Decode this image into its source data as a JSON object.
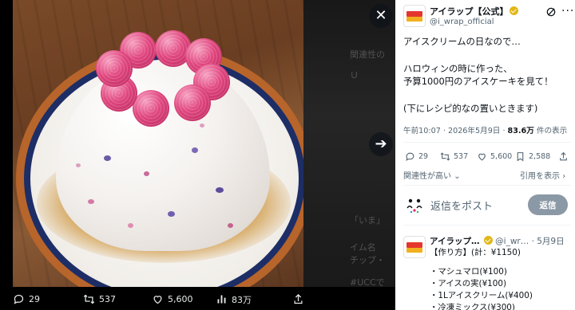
{
  "viewer": {
    "background_ghost_lines": [
      "関連性の",
      "Ｕ",
      "「いま」",
      "イム名",
      "チップ・",
      "#UCCで"
    ],
    "actions": {
      "reply_count": "29",
      "retweet_count": "537",
      "like_count": "5,600",
      "view_count": "83万"
    }
  },
  "post": {
    "author_name": "アイラップ【公式】",
    "author_handle": "@i_wrap_official",
    "text_lines": [
      "アイスクリームの日なので…",
      "ハロウィンの時に作った、",
      "予算1000円のアイスケーキを見て！",
      "(下にレシピ的なの置いときます)"
    ],
    "timestamp": "午前10:07 · 2026年5月9日 · ",
    "views_number": "83.6万",
    "views_suffix": " 件の表示",
    "reply_count": "29",
    "retweet_count": "537",
    "like_count": "5,600",
    "bookmark_count": "2,588",
    "relevance_label": "関連性が高い",
    "quote_label": "引用を表示"
  },
  "reply_composer": {
    "placeholder": "返信をポスト",
    "button_label": "返信"
  },
  "reply": {
    "author_name": "アイラップ…",
    "meta": "@i_wr… · 5月9日",
    "lines": [
      "【作り方】(計：¥1150)",
      "・マシュマロ(¥100)",
      "・アイスの実(¥100)",
      "・1Lアイスクリーム(¥400)",
      "・冷凍ミックス(¥300)"
    ]
  },
  "colors": {
    "accent_verified": "#e2b719",
    "text_primary": "#0f1419",
    "text_secondary": "#536471",
    "reply_button": "#8b98a5",
    "viewer_bg": "#000000"
  }
}
